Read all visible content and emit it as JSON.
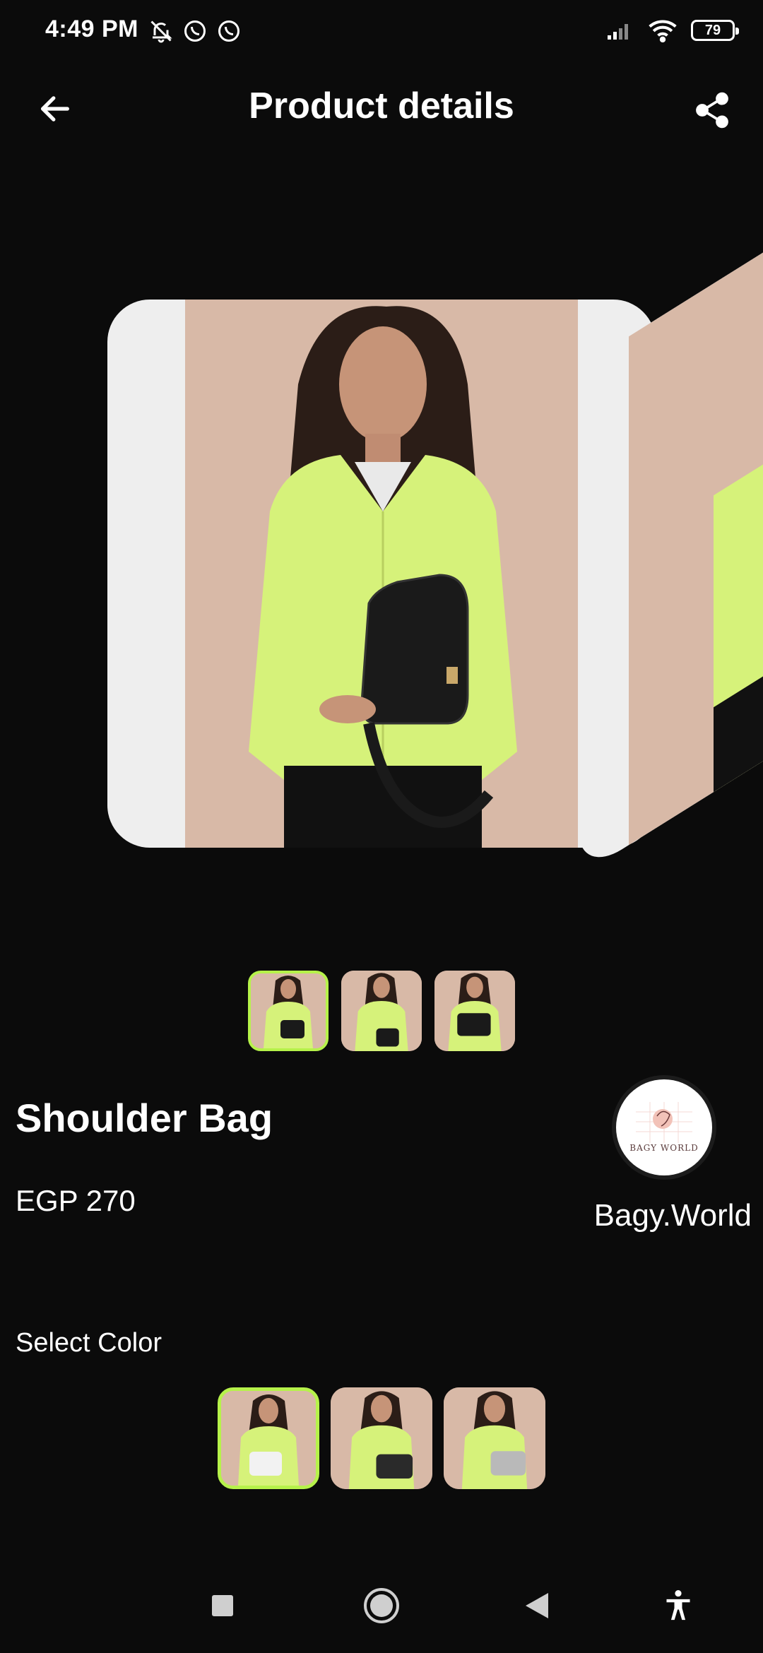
{
  "status_bar": {
    "time": "4:49 PM",
    "left_icons": [
      "bell-off-icon",
      "whatsapp-icon",
      "whatsapp-icon"
    ],
    "right_icons": [
      "signal-icon",
      "wifi-icon"
    ],
    "battery": "79"
  },
  "header": {
    "title": "Product details",
    "back_icon": "arrow-left-icon",
    "share_icon": "share-icon"
  },
  "carousel": {
    "image_count": 3,
    "selected_index": 0
  },
  "product": {
    "name": "Shoulder Bag",
    "price": "EGP 270"
  },
  "store": {
    "logo_text": "BAGY WORLD",
    "name": "Bagy.World"
  },
  "colors": {
    "label": "Select Color",
    "options": [
      {
        "bag_color": "#f2f2f2",
        "selected": true
      },
      {
        "bag_color": "#2a2a2a",
        "selected": false
      },
      {
        "bag_color": "#b9b9b9",
        "selected": false
      }
    ]
  },
  "palette": {
    "background": "#0b0b0b",
    "accent": "#b6f24a",
    "photo_backdrop": "#d8b9a7",
    "cardigan": "#d6f27a"
  },
  "nav_bar": [
    "recents-square-icon",
    "home-circle-icon",
    "back-triangle-icon",
    "accessibility-icon"
  ]
}
